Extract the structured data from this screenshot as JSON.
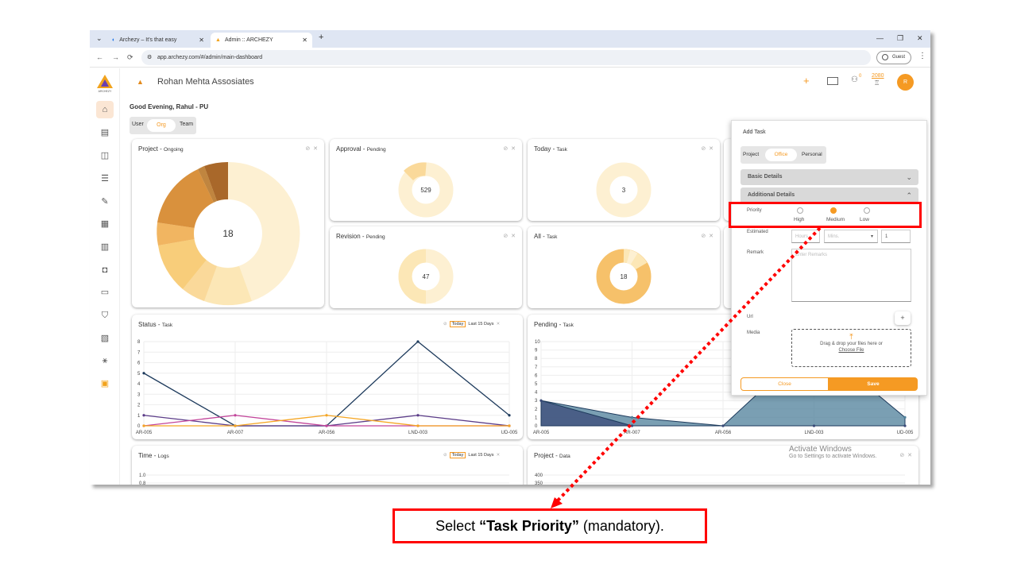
{
  "browser": {
    "tabs": [
      {
        "title": "Archezy – It's that easy"
      },
      {
        "title": "Admin :: ARCHEZY"
      }
    ],
    "url": "app.archezy.com/#/admin/main-dashboard",
    "profile": "Guest"
  },
  "app": {
    "logo_text": "ARCHEZY",
    "org_name": "Rohan Mehta Assosiates",
    "greeting": "Good Evening, Rahul - PU",
    "notification_count": "0",
    "points": "2080",
    "avatar_initial": "R",
    "scope_toggle": [
      "User",
      "Org",
      "Team"
    ],
    "scope_selected": "Org"
  },
  "cards": {
    "project": {
      "title": "Project -",
      "sub": "Ongoing",
      "center": "18"
    },
    "approval": {
      "title": "Approval -",
      "sub": "Pending",
      "center": "529"
    },
    "today": {
      "title": "Today -",
      "sub": "Task",
      "center": "3"
    },
    "revision": {
      "title": "Revision -",
      "sub": "Pending",
      "center": "47"
    },
    "all": {
      "title": "All -",
      "sub": "Task",
      "center": "18"
    },
    "status": {
      "title": "Status -",
      "sub": "Task",
      "f1": "Today",
      "f2": "Last 15 Days"
    },
    "pending": {
      "title": "Pending -",
      "sub": "Task"
    },
    "time": {
      "title": "Time -",
      "sub": "Logs",
      "f1": "Today",
      "f2": "Last 15 Days"
    },
    "projdata": {
      "title": "Project -",
      "sub": "Data"
    }
  },
  "chart_data": [
    {
      "type": "line",
      "title": "Status - Task",
      "categories": [
        "AR-005",
        "AR-007",
        "AR-056",
        "LND-003",
        "UD-005"
      ],
      "ylim": [
        0,
        8
      ],
      "yticks": [
        "0",
        "1",
        "2",
        "3",
        "4",
        "5",
        "6",
        "7",
        "8"
      ],
      "series": [
        {
          "color": "#1d3a5c",
          "values": [
            5,
            0,
            0,
            8,
            1
          ]
        },
        {
          "color": "#5b3c88",
          "values": [
            1,
            0,
            0,
            1,
            0
          ]
        },
        {
          "color": "#c2449a",
          "values": [
            0,
            1,
            0,
            0,
            0
          ]
        },
        {
          "color": "#f5a623",
          "values": [
            0,
            0,
            1,
            0,
            0
          ]
        }
      ]
    },
    {
      "type": "area",
      "title": "Pending - Task",
      "categories": [
        "AR-005",
        "AR-007",
        "AR-056",
        "LND-003",
        "UD-005"
      ],
      "ylim": [
        0,
        10
      ],
      "yticks": [
        "0",
        "1",
        "2",
        "3",
        "4",
        "5",
        "6",
        "7",
        "8",
        "9",
        "10"
      ],
      "series": [
        {
          "color": "#4d7f99",
          "values": [
            3,
            1,
            0,
            10,
            1
          ]
        },
        {
          "color": "#3b4a78",
          "values": [
            3,
            0,
            0,
            0,
            0
          ]
        }
      ]
    },
    {
      "type": "line",
      "title": "Time - Logs",
      "yticks": [
        "1.0",
        "0.8"
      ]
    },
    {
      "type": "line",
      "title": "Project - Data",
      "yticks": [
        "400",
        "350"
      ]
    }
  ],
  "add_task": {
    "title": "Add Task",
    "type_toggle": [
      "Project",
      "Office",
      "Personal"
    ],
    "type_selected": "Office",
    "basic_details": "Basic Details",
    "additional_details": "Additional Details",
    "priority_label": "Priority",
    "priorities": [
      "High",
      "Medium",
      "Low"
    ],
    "priority_selected": "Medium",
    "estimated_label": "Estimated",
    "hours_placeholder": "Hours",
    "mins_placeholder": "Mins.",
    "estimated_value": "1",
    "remark_label": "Remark",
    "remark_placeholder": "Enter Remarks",
    "url_label": "Url",
    "media_label": "Media",
    "drop_text": "Drag & drop your files here or",
    "choose_file": "Choose File",
    "close": "Close",
    "save": "Save"
  },
  "watermark": {
    "line1": "Activate Windows",
    "line2": "Go to Settings to activate Windows."
  },
  "callout": {
    "pre": "Select ",
    "bold": "“Task Priority”",
    "post": " (mandatory)."
  },
  "colors": {
    "accent": "#f59a23",
    "highlight": "#ff0000"
  }
}
